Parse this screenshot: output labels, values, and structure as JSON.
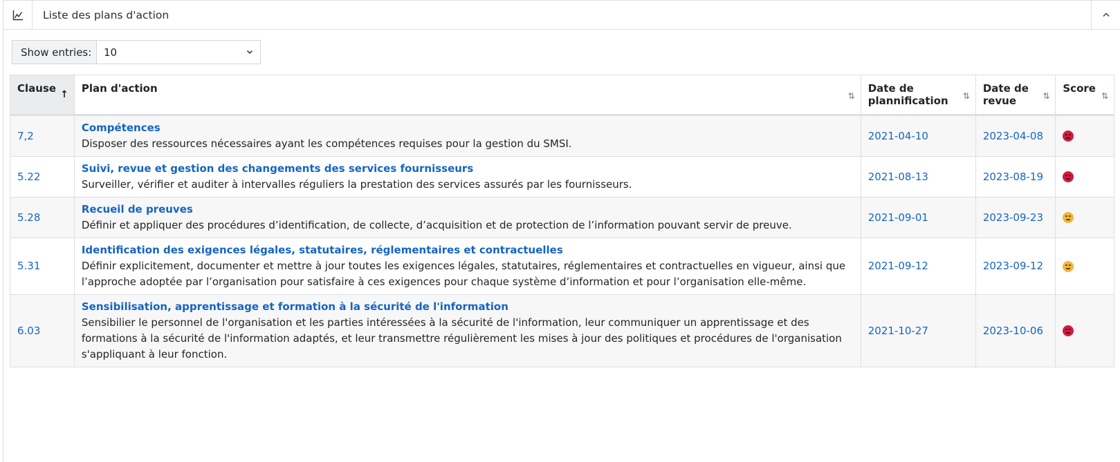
{
  "panel": {
    "title": "Liste des plans d'action",
    "header_icon": "line-chart-icon",
    "collapse_icon": "chevron-up-icon"
  },
  "length_menu": {
    "label": "Show entries:",
    "value": "10"
  },
  "table": {
    "columns": [
      {
        "label": "Clause",
        "sort": "asc"
      },
      {
        "label": "Plan d'action",
        "sort": "none"
      },
      {
        "label": "Date de plannification",
        "sort": "none"
      },
      {
        "label": "Date de revue",
        "sort": "none"
      },
      {
        "label": "Score",
        "sort": "none"
      }
    ],
    "rows": [
      {
        "clause": "7,2",
        "title": "Compétences",
        "description": "Disposer des ressources nécessaires ayant les compétences requises pour la gestion du SMSI.",
        "plan_date": "2021-04-10",
        "review_date": "2023-04-08",
        "score": "bad"
      },
      {
        "clause": "5.22",
        "title": "Suivi, revue et gestion des changements des services fournisseurs",
        "description": "Surveiller, vérifier et auditer à intervalles réguliers la prestation des services assurés par les fournisseurs.",
        "plan_date": "2021-08-13",
        "review_date": "2023-08-19",
        "score": "bad"
      },
      {
        "clause": "5.28",
        "title": "Recueil de preuves",
        "description": "Définir et appliquer des procédures d’identification, de collecte, d’acquisition et de protection de l’information pouvant servir de preuve.",
        "plan_date": "2021-09-01",
        "review_date": "2023-09-23",
        "score": "neutral"
      },
      {
        "clause": "5.31",
        "title": "Identification des exigences légales, statutaires, réglementaires et contractuelles",
        "description": "Définir explicitement, documenter et mettre à jour toutes les exigences légales, statutaires, réglementaires et contractuelles en vigueur, ainsi que l’approche adoptée par l’organisation pour satisfaire à ces exigences pour chaque système d’information et pour l’organisation elle-même.",
        "plan_date": "2021-09-12",
        "review_date": "2023-09-12",
        "score": "neutral"
      },
      {
        "clause": "6.03",
        "title": "Sensibilisation, apprentissage et formation à la sécurité de l'information",
        "description": "Sensibilier le personnel de l'organisation et les parties intéressées  à la sécurité de l'information, leur communiquer un apprentissage et des formations à la sécurité de l'information adaptés, et leur transmettre régulièrement les mises à jour des politiques et procédures de l'organisation s'appliquant à leur fonction.",
        "plan_date": "2021-10-27",
        "review_date": "2023-10-06",
        "score": "bad"
      }
    ]
  },
  "colors": {
    "link": "#1565c0",
    "score_bad": "#d21a40",
    "score_neutral": "#f2b53a"
  }
}
